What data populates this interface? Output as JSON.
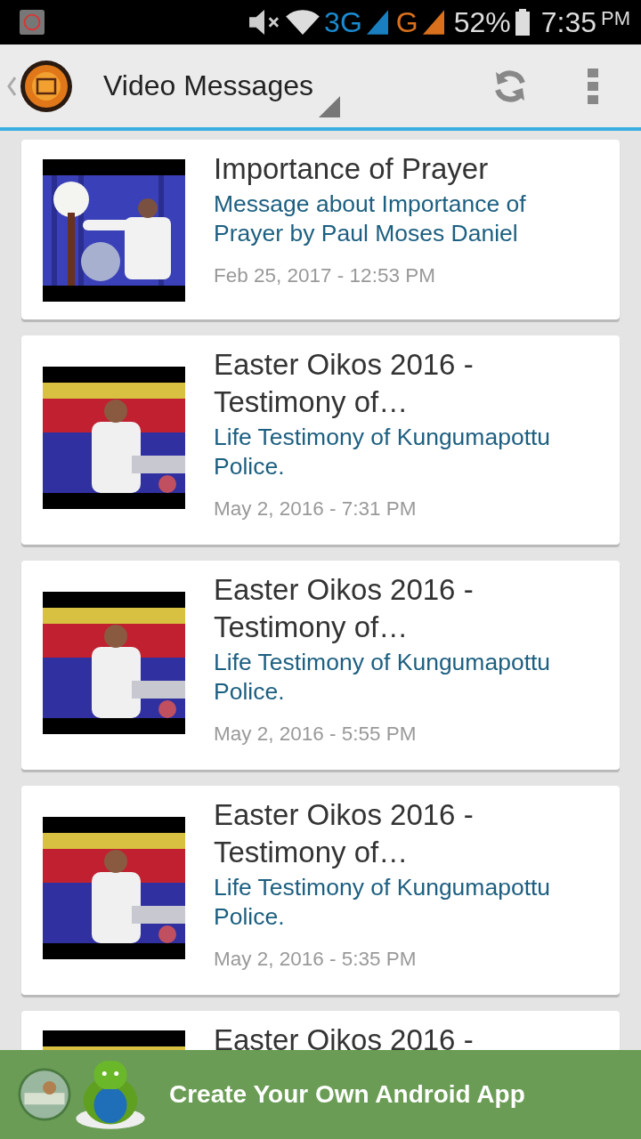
{
  "status_bar": {
    "network_3g": "3G",
    "network_g": "G",
    "battery": "52%",
    "time": "7:35",
    "ampm": "PM"
  },
  "app_bar": {
    "title": "Video Messages"
  },
  "videos": [
    {
      "title": "Importance of Prayer",
      "description": "Message about Importance of Prayer by Paul Moses Daniel",
      "date": "Feb 25, 2017 - 12:53 PM"
    },
    {
      "title": "Easter Oikos 2016 - Testimony of…",
      "description": "Life Testimony of Kungumapottu Police.",
      "date": "May 2, 2016 - 7:31 PM"
    },
    {
      "title": "Easter Oikos 2016 - Testimony of…",
      "description": "Life Testimony of Kungumapottu Police.",
      "date": "May 2, 2016 - 5:55 PM"
    },
    {
      "title": "Easter Oikos 2016 - Testimony of…",
      "description": "Life Testimony of Kungumapottu Police.",
      "date": "May 2, 2016 - 5:35 PM"
    },
    {
      "title": "Easter Oikos 2016 -"
    }
  ],
  "banner": {
    "text": "Create Your Own Android App"
  }
}
